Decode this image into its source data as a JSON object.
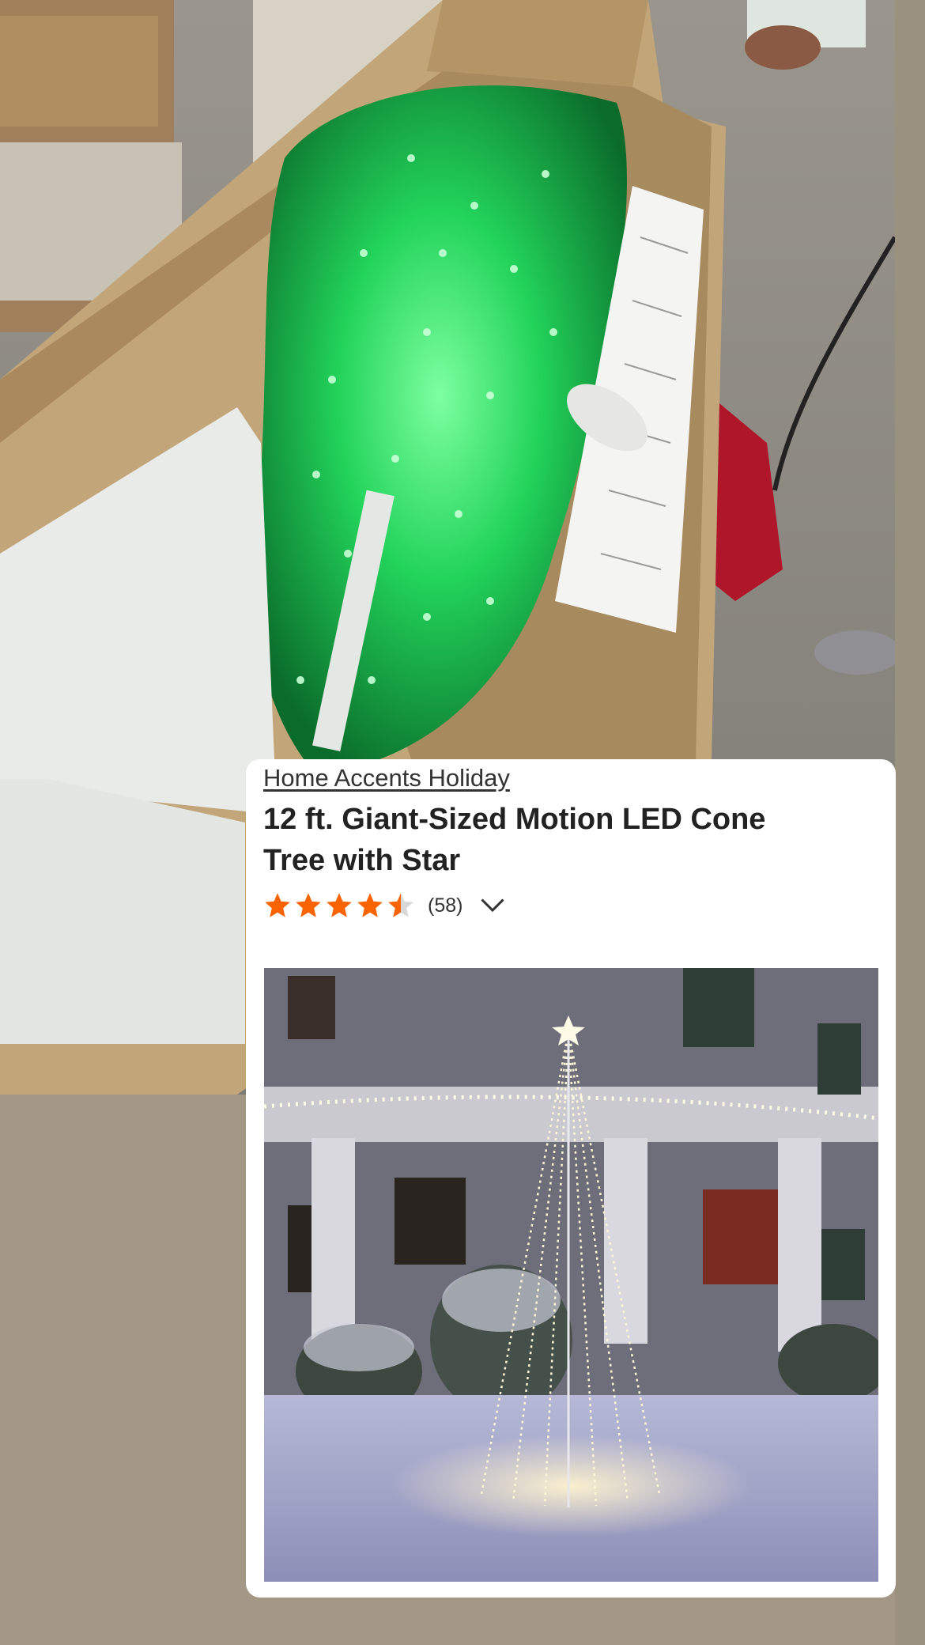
{
  "product_card": {
    "brand": "Home Accents Holiday",
    "title": "12 ft. Giant-Sized Motion LED Cone Tree with Star",
    "rating": {
      "value": 4.5,
      "max": 5,
      "review_count": "(58)"
    }
  },
  "colors": {
    "star_fill": "#f96302",
    "star_empty": "#d8d8d8",
    "led_green": "#2ee86a",
    "cardboard": "#c2a67a"
  },
  "icons": [
    "star-icon",
    "chevron-down-icon"
  ]
}
